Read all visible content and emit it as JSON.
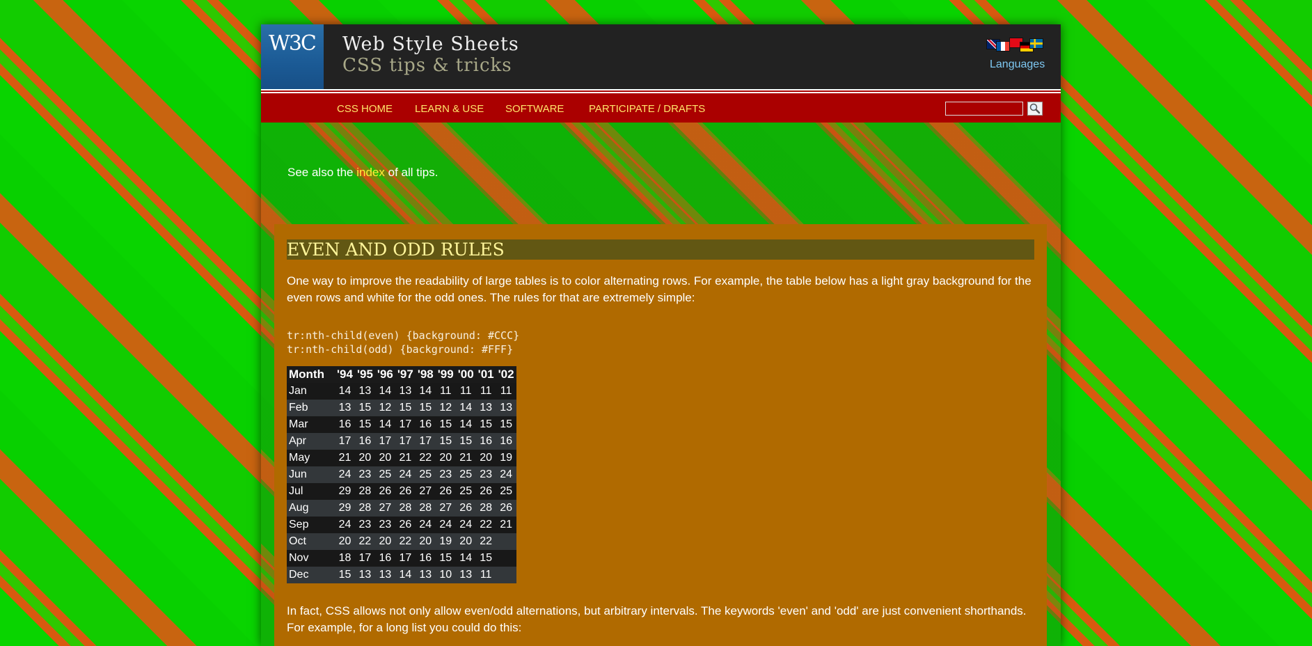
{
  "header": {
    "logo_text": "W3C",
    "title": "Web Style Sheets",
    "subtitle": "CSS tips & tricks",
    "languages_label": "Languages"
  },
  "nav": {
    "items": [
      {
        "label": "CSS HOME"
      },
      {
        "label": "LEARN & USE"
      },
      {
        "label": "SOFTWARE"
      },
      {
        "label": "PARTICIPATE / DRAFTS"
      }
    ],
    "search_value": "",
    "search_icon": "magnifier-icon"
  },
  "see_also": {
    "before": "See also the ",
    "link": "index",
    "after": " of all tips."
  },
  "article": {
    "heading": "EVEN AND ODD RULES",
    "para1": "One way to improve the readability of large tables is to color alternating rows. For example, the table below has a light gray background for the even rows and white for the odd ones. The rules for that are extremely simple:",
    "code_lines": [
      "tr:nth-child(even) {background: #CCC}",
      "tr:nth-child(odd) {background: #FFF}"
    ],
    "table": {
      "headers": [
        "Month",
        "'94",
        "'95",
        "'96",
        "'97",
        "'98",
        "'99",
        "'00",
        "'01",
        "'02"
      ],
      "rows": [
        [
          "Jan",
          "14",
          "13",
          "14",
          "13",
          "14",
          "11",
          "11",
          "11",
          "11"
        ],
        [
          "Feb",
          "13",
          "15",
          "12",
          "15",
          "15",
          "12",
          "14",
          "13",
          "13"
        ],
        [
          "Mar",
          "16",
          "15",
          "14",
          "17",
          "16",
          "15",
          "14",
          "15",
          "15"
        ],
        [
          "Apr",
          "17",
          "16",
          "17",
          "17",
          "17",
          "15",
          "15",
          "16",
          "16"
        ],
        [
          "May",
          "21",
          "20",
          "20",
          "21",
          "22",
          "20",
          "21",
          "20",
          "19"
        ],
        [
          "Jun",
          "24",
          "23",
          "25",
          "24",
          "25",
          "23",
          "25",
          "23",
          "24"
        ],
        [
          "Jul",
          "29",
          "28",
          "26",
          "26",
          "27",
          "26",
          "25",
          "26",
          "25"
        ],
        [
          "Aug",
          "29",
          "28",
          "27",
          "28",
          "28",
          "27",
          "26",
          "28",
          "26"
        ],
        [
          "Sep",
          "24",
          "23",
          "23",
          "26",
          "24",
          "24",
          "24",
          "22",
          "21"
        ],
        [
          "Oct",
          "20",
          "22",
          "20",
          "22",
          "20",
          "19",
          "20",
          "22",
          ""
        ],
        [
          "Nov",
          "18",
          "17",
          "16",
          "17",
          "16",
          "15",
          "14",
          "15",
          ""
        ],
        [
          "Dec",
          "15",
          "13",
          "13",
          "14",
          "13",
          "10",
          "13",
          "11",
          ""
        ]
      ]
    },
    "para2": "In fact, CSS allows not only allow even/odd alternations, but arbitrary intervals. The keywords 'even' and 'odd' are just convenient shorthands. For example, for a long list you could do this:"
  },
  "colors": {
    "header_bg": "#222222",
    "nav_bg": "#aa0000",
    "nav_text": "#ffe46a",
    "content_bg": "#b06a00",
    "heading_bg": "#625713",
    "heading_text": "#fff59a",
    "link": "#ffef3a"
  }
}
